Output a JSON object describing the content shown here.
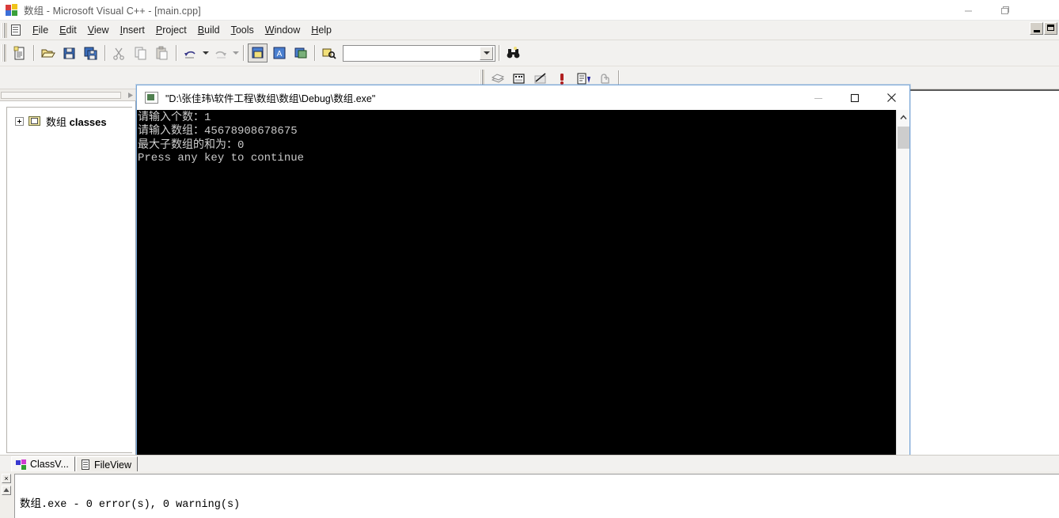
{
  "window": {
    "title_prefix": "数组",
    "title_rest": " - Microsoft Visual C++ - [main.cpp]",
    "icon": "vc-logo-icon",
    "controls": {
      "minimize": "minimize-icon",
      "maximize": "maximize-icon",
      "close": "close-icon"
    }
  },
  "menubar": {
    "items": [
      {
        "label": "File",
        "accel": "F"
      },
      {
        "label": "Edit",
        "accel": "E"
      },
      {
        "label": "View",
        "accel": "V"
      },
      {
        "label": "Insert",
        "accel": "I"
      },
      {
        "label": "Project",
        "accel": "P"
      },
      {
        "label": "Build",
        "accel": "B"
      },
      {
        "label": "Tools",
        "accel": "T"
      },
      {
        "label": "Window",
        "accel": "W"
      },
      {
        "label": "Help",
        "accel": "H"
      }
    ],
    "mdi_minimize": "mdi-minimize-icon",
    "mdi_restore": "mdi-restore-icon"
  },
  "toolbar_standard": {
    "buttons": [
      "new-document-icon",
      "open-folder-icon",
      "save-icon",
      "save-all-icon",
      "cut-icon",
      "copy-icon",
      "paste-icon",
      "undo-icon",
      "redo-icon",
      "workspace-toggle-icon",
      "output-toggle-icon",
      "window-list-icon",
      "find-icon"
    ],
    "find_combo": {
      "value": "",
      "placeholder": "",
      "dropdown_icon": "chevron-down-icon"
    },
    "find_in_files_icon": "binoculars-icon"
  },
  "toolbar_build": {
    "buttons": [
      "compile-icon",
      "build-icon",
      "stop-build-icon",
      "execute-program-icon",
      "go-icon",
      "insert-breakpoint-icon"
    ]
  },
  "workspace": {
    "hscrollbar": "horizontal-scrollbar",
    "tree": [
      {
        "label_cjk": "数组",
        "label_en": " classes",
        "expanded": false,
        "icon": "class-folder-icon"
      }
    ],
    "tabs": [
      {
        "label": "ClassV...",
        "icon": "classview-icon",
        "active": true
      },
      {
        "label": "FileView",
        "icon": "fileview-icon",
        "active": false
      }
    ]
  },
  "output_pane": {
    "close_label": "×",
    "scroll_icon": "scroll-up-icon",
    "line_cjk": "数组",
    "line_rest": ".exe - 0 error(s), 0 warning(s)"
  },
  "console": {
    "title_quote_open": "\"D:\\",
    "title_cjk1": "张佳玮",
    "title_sep1": "\\",
    "title_cjk2": "软件工程",
    "title_sep2": "\\",
    "title_cjk3": "数组",
    "title_sep3": "\\",
    "title_cjk4": "数组",
    "title_sep4": "\\Debug\\",
    "title_cjk5": "数组",
    "title_end": ".exe\"",
    "icon": "console-window-icon",
    "controls": {
      "minimize": "minimize-icon",
      "maximize": "maximize-icon",
      "close": "close-icon"
    },
    "lines": [
      {
        "cjk": "请输入个数：",
        "rest": "1"
      },
      {
        "cjk": "请输入数组：",
        "rest": "45678908678675"
      },
      {
        "cjk": "最大子数组的和为：",
        "rest": "0"
      },
      {
        "cjk": "",
        "rest": "Press any key to continue"
      }
    ],
    "scrollbar": {
      "up_icon": "chevron-up-icon",
      "down_icon": "chevron-down-icon",
      "thumb": "scroll-thumb"
    }
  },
  "colors": {
    "console_bg": "#000000",
    "console_fg": "#c8c8c8",
    "ide_chrome": "#f2f1ef",
    "console_border": "#7ca9d8"
  }
}
